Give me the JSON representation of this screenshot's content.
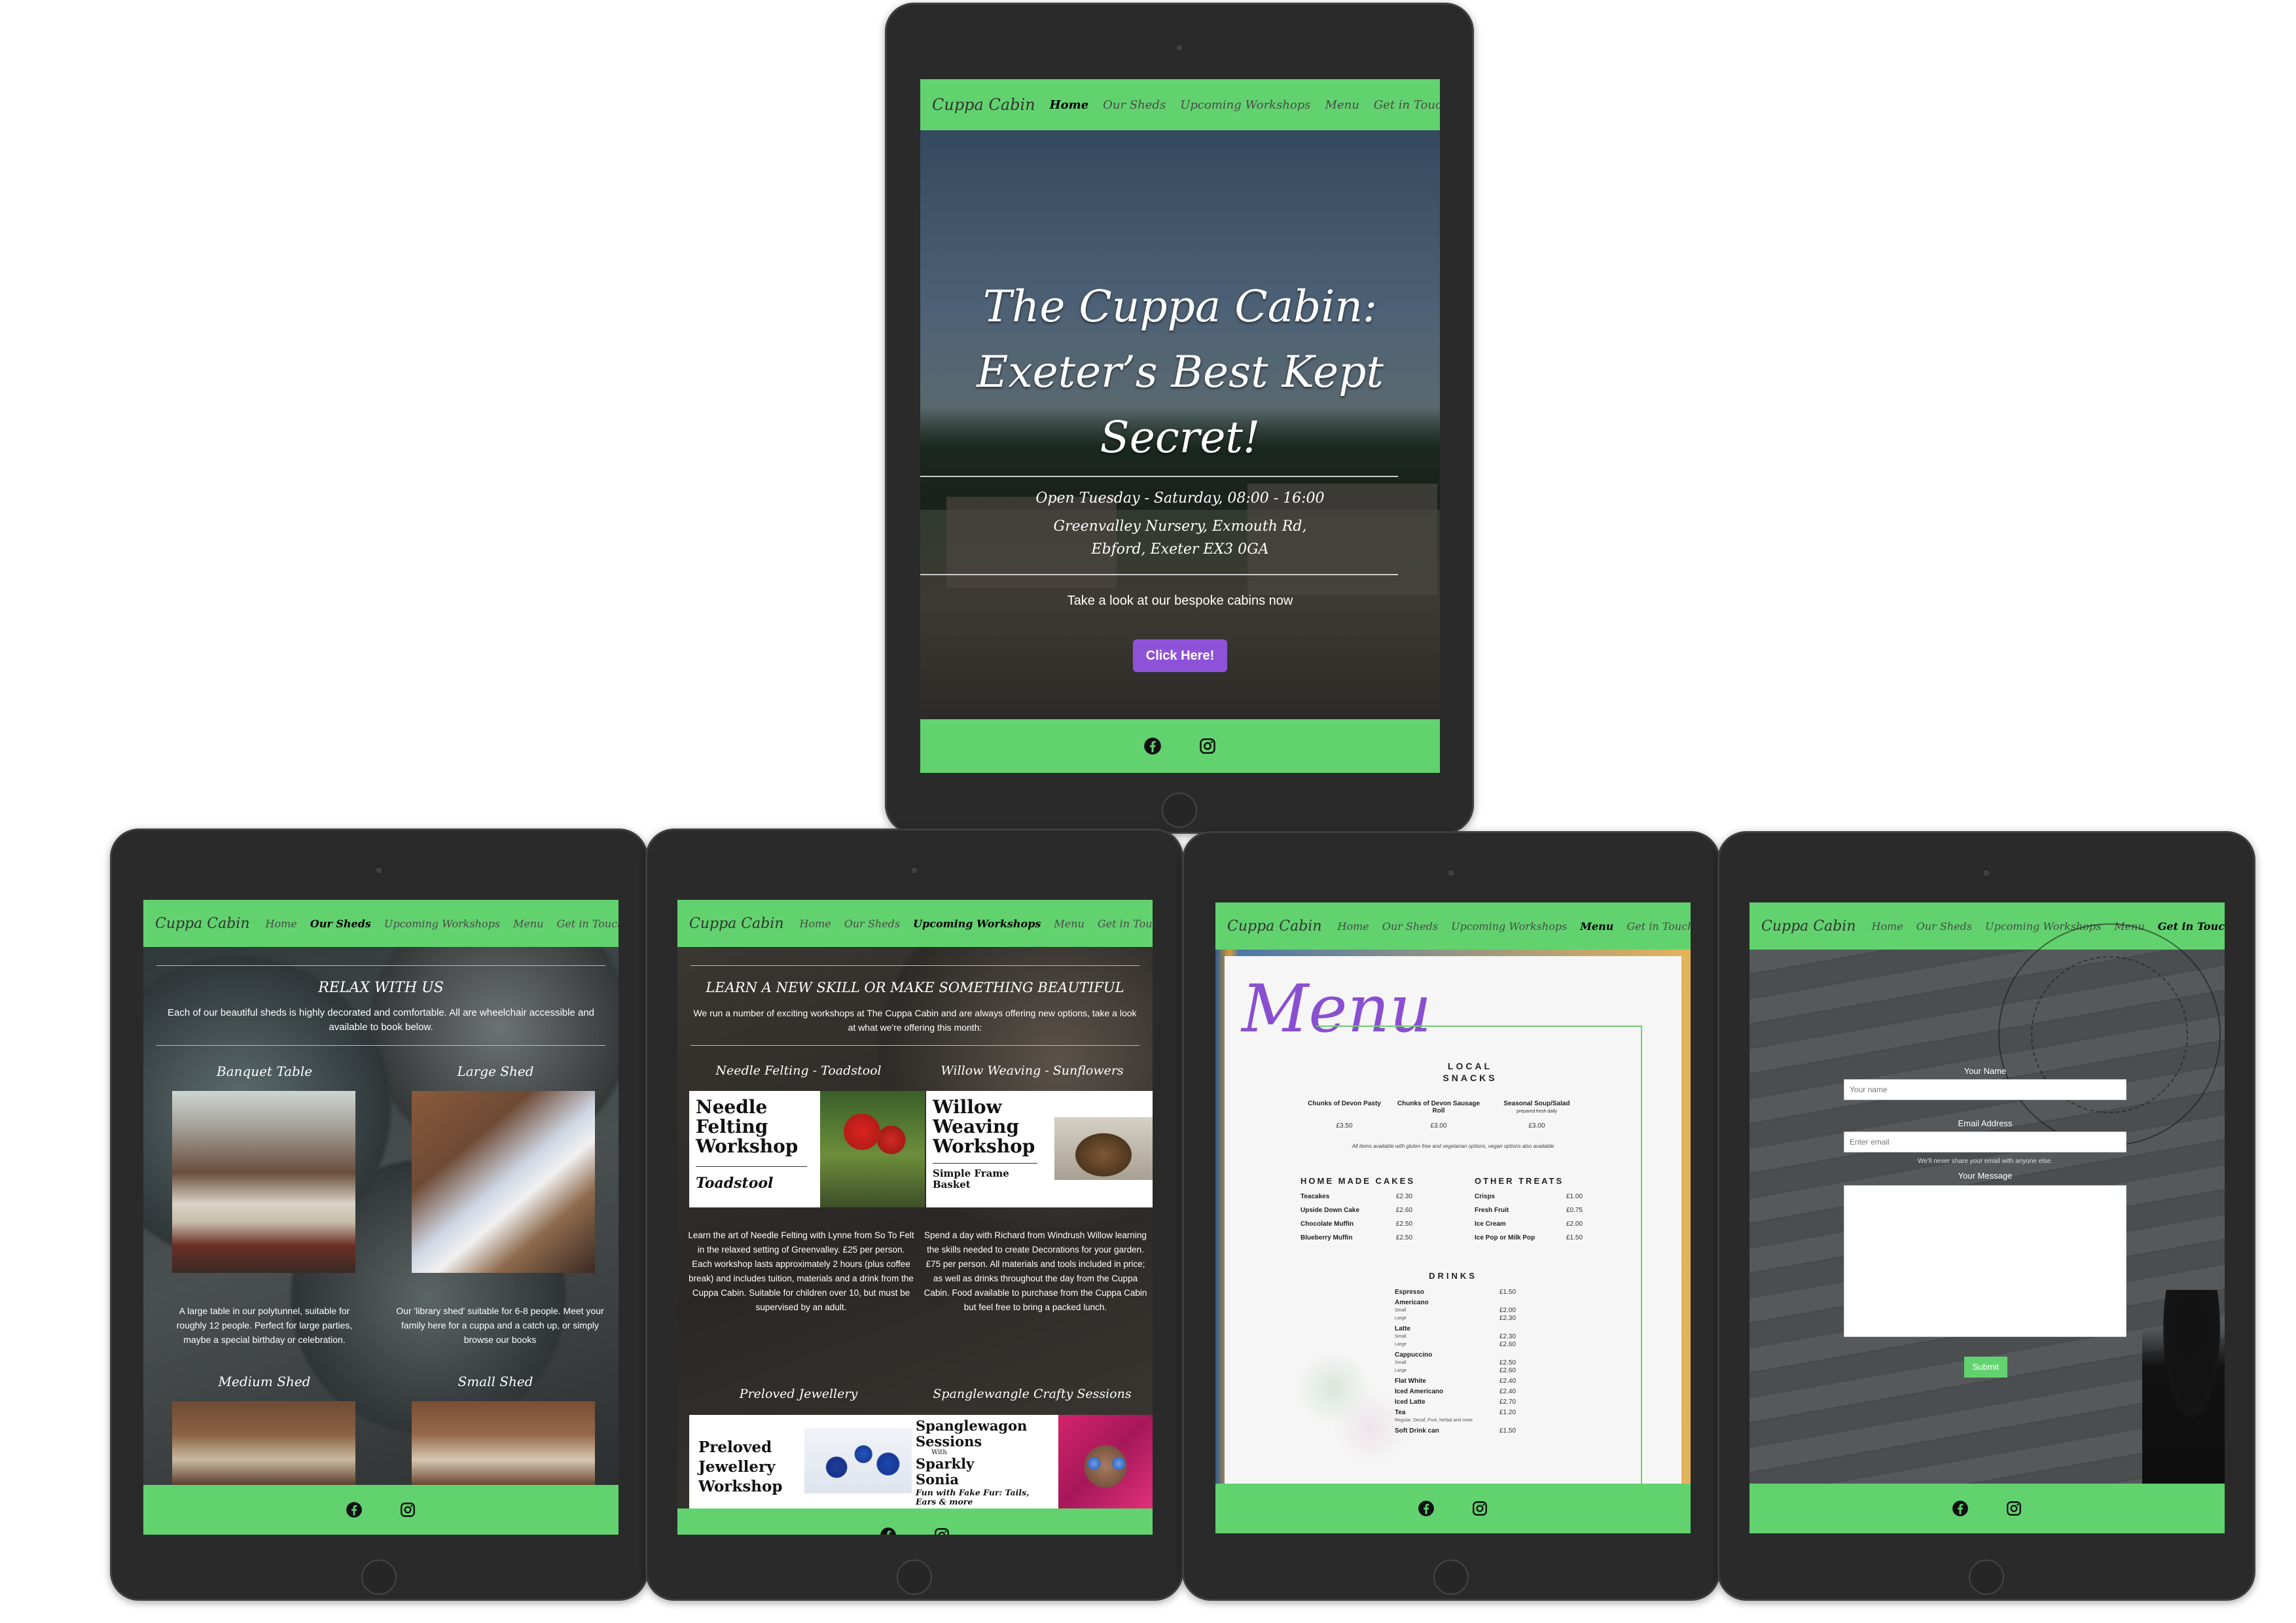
{
  "nav": {
    "brand": "Cuppa Cabin",
    "items": [
      "Home",
      "Our Sheds",
      "Upcoming Workshops",
      "Menu",
      "Get in Touch"
    ]
  },
  "colors": {
    "nav": "#62d26f",
    "button": "#8e52d9",
    "device": "#2a2a2b"
  },
  "icons": {
    "facebook": "facebook-icon",
    "instagram": "instagram-icon"
  },
  "home": {
    "active": "Home",
    "title_lines": [
      "The Cuppa Cabin:",
      "Exeter’s Best Kept",
      "Secret!"
    ],
    "hours": "Open Tuesday - Saturday, 08:00 - 16:00",
    "address_lines": [
      "Greenvalley Nursery, Exmouth Rd,",
      "Ebford, Exeter EX3 0GA"
    ],
    "cta_text": "Take a look at our bespoke cabins now",
    "cta_button": "Click Here!"
  },
  "sheds": {
    "active": "Our Sheds",
    "heading": "RELAX WITH US",
    "intro": "Each of our beautiful sheds is highly decorated and comfortable. All are wheelchair accessible and available to book below.",
    "items": [
      {
        "title": "Banquet Table",
        "desc": "A large table in our polytunnel, suitable for roughly 12 people. Perfect for large parties, maybe a special birthday or celebration."
      },
      {
        "title": "Large Shed",
        "desc": "Our 'library shed' suitable for 6-8 people. Meet your family here for a cuppa and a catch up, or simply browse our books"
      },
      {
        "title": "Medium Shed",
        "desc": ""
      },
      {
        "title": "Small Shed",
        "desc": ""
      }
    ]
  },
  "workshops": {
    "active": "Upcoming Workshops",
    "heading": "LEARN A NEW SKILL OR MAKE SOMETHING BEAUTIFUL",
    "intro": "We run a number of exciting workshops at The Cuppa Cabin and are always offering new options, take a look at what we're offering this month:",
    "items": [
      {
        "title": "Needle Felting - Toadstool",
        "poster_lines": [
          "Needle",
          "Felting",
          "Workshop"
        ],
        "poster_sub": "Toadstool",
        "desc": "Learn the art of Needle Felting with Lynne from So To Felt in the relaxed setting of Greenvalley. £25 per person. Each workshop lasts approximately 2 hours (plus coffee break) and includes tuition, materials and a drink from the Cuppa Cabin. Suitable for children over 10, but must be supervised by an adult."
      },
      {
        "title": "Willow Weaving - Sunflowers",
        "poster_lines": [
          "Willow",
          "Weaving",
          "Workshop"
        ],
        "poster_sub": "Simple Frame Basket",
        "desc": "Spend a day with Richard from Windrush Willow learning the skills needed to create Decorations for your garden. £75 per person. All materials and tools included in price; as well as drinks throughout the day from the Cuppa Cabin. Food available to purchase from the Cuppa Cabin but feel free to bring a packed lunch."
      },
      {
        "title": "Preloved Jewellery",
        "poster_lines": [
          "Preloved",
          "Jewellery",
          "Workshop"
        ],
        "poster_sub": "",
        "desc": ""
      },
      {
        "title": "Spanglewangle Crafty Sessions",
        "poster_lines": [
          "Spanglewagon",
          "Sessions",
          "With",
          "Sparkly",
          "Sonia"
        ],
        "poster_sub": "Fun with Fake Fur: Tails, Ears & more",
        "desc": ""
      }
    ]
  },
  "menu": {
    "active": "Menu",
    "title": "Menu",
    "local_heading_lines": [
      "LOCAL",
      "SNACKS"
    ],
    "local": [
      {
        "name": "Chunks of Devon Pasty",
        "note": "",
        "price": "£3.50"
      },
      {
        "name": "Chunks of Devon Sausage Roll",
        "note": "",
        "price": "£3.00"
      },
      {
        "name": "Seasonal Soup/Salad",
        "note": "prepared fresh daily",
        "price": "£3.00"
      }
    ],
    "allergy_note": "All items available with gluten free and vegetarian options, vegan options also available",
    "cakes_heading": "HOME MADE CAKES",
    "cakes": [
      {
        "name": "Teacakes",
        "price": "£2.30"
      },
      {
        "name": "Upside Down Cake",
        "price": "£2.60"
      },
      {
        "name": "Chocolate Muffin",
        "price": "£2.50"
      },
      {
        "name": "Blueberry Muffin",
        "price": "£2.50"
      }
    ],
    "treats_heading": "OTHER TREATS",
    "treats": [
      {
        "name": "Crisps",
        "price": "£1.00"
      },
      {
        "name": "Fresh Fruit",
        "price": "£0.75"
      },
      {
        "name": "Ice Cream",
        "price": "£2.00"
      },
      {
        "name": "Ice Pop or Milk Pop",
        "price": "£1.50"
      }
    ],
    "drinks_heading": "DRINKS",
    "drinks": [
      {
        "name": "Espresso",
        "sub": "",
        "prices": [
          "£1.50"
        ]
      },
      {
        "name": "Americano",
        "sub": "Small\nLarge",
        "prices": [
          "£2.00",
          "£2.30"
        ]
      },
      {
        "name": "Latte",
        "sub": "Small\nLarge",
        "prices": [
          "£2.30",
          "£2.60"
        ]
      },
      {
        "name": "Cappuccino",
        "sub": "Small\nLarge",
        "prices": [
          "£2.50",
          "£2.60"
        ]
      },
      {
        "name": "Flat White",
        "sub": "",
        "prices": [
          "£2.40"
        ]
      },
      {
        "name": "Iced Americano",
        "sub": "",
        "prices": [
          "£2.40"
        ]
      },
      {
        "name": "Iced Latte",
        "sub": "",
        "prices": [
          "£2.70"
        ]
      },
      {
        "name": "Tea",
        "sub": "Regular, Decaf, Fruit, herbal and more",
        "prices": [
          "£1.20"
        ]
      },
      {
        "name": "Soft Drink can",
        "sub": "",
        "prices": [
          "£1.50"
        ]
      }
    ]
  },
  "contact": {
    "active": "Get in Touch",
    "name_label": "Your Name",
    "name_placeholder": "Your name",
    "email_label": "Email Address",
    "email_placeholder": "Enter email",
    "email_help": "We'll never share your email with anyone else.",
    "message_label": "Your Message",
    "submit": "Submit"
  }
}
